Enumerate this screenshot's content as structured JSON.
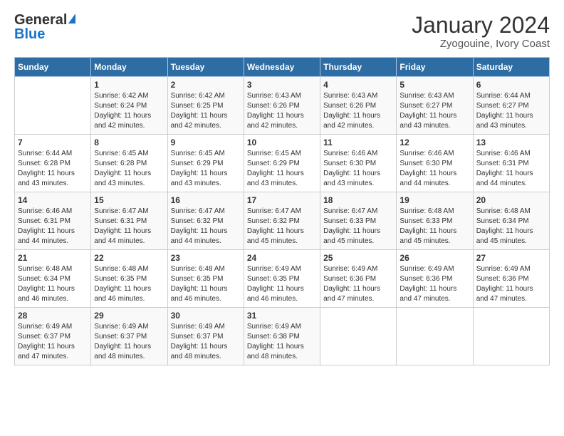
{
  "header": {
    "logo_general": "General",
    "logo_blue": "Blue",
    "month_title": "January 2024",
    "location": "Zyogouine, Ivory Coast"
  },
  "weekdays": [
    "Sunday",
    "Monday",
    "Tuesday",
    "Wednesday",
    "Thursday",
    "Friday",
    "Saturday"
  ],
  "weeks": [
    [
      {
        "day": "",
        "info": ""
      },
      {
        "day": "1",
        "info": "Sunrise: 6:42 AM\nSunset: 6:24 PM\nDaylight: 11 hours\nand 42 minutes."
      },
      {
        "day": "2",
        "info": "Sunrise: 6:42 AM\nSunset: 6:25 PM\nDaylight: 11 hours\nand 42 minutes."
      },
      {
        "day": "3",
        "info": "Sunrise: 6:43 AM\nSunset: 6:26 PM\nDaylight: 11 hours\nand 42 minutes."
      },
      {
        "day": "4",
        "info": "Sunrise: 6:43 AM\nSunset: 6:26 PM\nDaylight: 11 hours\nand 42 minutes."
      },
      {
        "day": "5",
        "info": "Sunrise: 6:43 AM\nSunset: 6:27 PM\nDaylight: 11 hours\nand 43 minutes."
      },
      {
        "day": "6",
        "info": "Sunrise: 6:44 AM\nSunset: 6:27 PM\nDaylight: 11 hours\nand 43 minutes."
      }
    ],
    [
      {
        "day": "7",
        "info": "Sunrise: 6:44 AM\nSunset: 6:28 PM\nDaylight: 11 hours\nand 43 minutes."
      },
      {
        "day": "8",
        "info": "Sunrise: 6:45 AM\nSunset: 6:28 PM\nDaylight: 11 hours\nand 43 minutes."
      },
      {
        "day": "9",
        "info": "Sunrise: 6:45 AM\nSunset: 6:29 PM\nDaylight: 11 hours\nand 43 minutes."
      },
      {
        "day": "10",
        "info": "Sunrise: 6:45 AM\nSunset: 6:29 PM\nDaylight: 11 hours\nand 43 minutes."
      },
      {
        "day": "11",
        "info": "Sunrise: 6:46 AM\nSunset: 6:30 PM\nDaylight: 11 hours\nand 43 minutes."
      },
      {
        "day": "12",
        "info": "Sunrise: 6:46 AM\nSunset: 6:30 PM\nDaylight: 11 hours\nand 44 minutes."
      },
      {
        "day": "13",
        "info": "Sunrise: 6:46 AM\nSunset: 6:31 PM\nDaylight: 11 hours\nand 44 minutes."
      }
    ],
    [
      {
        "day": "14",
        "info": "Sunrise: 6:46 AM\nSunset: 6:31 PM\nDaylight: 11 hours\nand 44 minutes."
      },
      {
        "day": "15",
        "info": "Sunrise: 6:47 AM\nSunset: 6:31 PM\nDaylight: 11 hours\nand 44 minutes."
      },
      {
        "day": "16",
        "info": "Sunrise: 6:47 AM\nSunset: 6:32 PM\nDaylight: 11 hours\nand 44 minutes."
      },
      {
        "day": "17",
        "info": "Sunrise: 6:47 AM\nSunset: 6:32 PM\nDaylight: 11 hours\nand 45 minutes."
      },
      {
        "day": "18",
        "info": "Sunrise: 6:47 AM\nSunset: 6:33 PM\nDaylight: 11 hours\nand 45 minutes."
      },
      {
        "day": "19",
        "info": "Sunrise: 6:48 AM\nSunset: 6:33 PM\nDaylight: 11 hours\nand 45 minutes."
      },
      {
        "day": "20",
        "info": "Sunrise: 6:48 AM\nSunset: 6:34 PM\nDaylight: 11 hours\nand 45 minutes."
      }
    ],
    [
      {
        "day": "21",
        "info": "Sunrise: 6:48 AM\nSunset: 6:34 PM\nDaylight: 11 hours\nand 46 minutes."
      },
      {
        "day": "22",
        "info": "Sunrise: 6:48 AM\nSunset: 6:35 PM\nDaylight: 11 hours\nand 46 minutes."
      },
      {
        "day": "23",
        "info": "Sunrise: 6:48 AM\nSunset: 6:35 PM\nDaylight: 11 hours\nand 46 minutes."
      },
      {
        "day": "24",
        "info": "Sunrise: 6:49 AM\nSunset: 6:35 PM\nDaylight: 11 hours\nand 46 minutes."
      },
      {
        "day": "25",
        "info": "Sunrise: 6:49 AM\nSunset: 6:36 PM\nDaylight: 11 hours\nand 47 minutes."
      },
      {
        "day": "26",
        "info": "Sunrise: 6:49 AM\nSunset: 6:36 PM\nDaylight: 11 hours\nand 47 minutes."
      },
      {
        "day": "27",
        "info": "Sunrise: 6:49 AM\nSunset: 6:36 PM\nDaylight: 11 hours\nand 47 minutes."
      }
    ],
    [
      {
        "day": "28",
        "info": "Sunrise: 6:49 AM\nSunset: 6:37 PM\nDaylight: 11 hours\nand 47 minutes."
      },
      {
        "day": "29",
        "info": "Sunrise: 6:49 AM\nSunset: 6:37 PM\nDaylight: 11 hours\nand 48 minutes."
      },
      {
        "day": "30",
        "info": "Sunrise: 6:49 AM\nSunset: 6:37 PM\nDaylight: 11 hours\nand 48 minutes."
      },
      {
        "day": "31",
        "info": "Sunrise: 6:49 AM\nSunset: 6:38 PM\nDaylight: 11 hours\nand 48 minutes."
      },
      {
        "day": "",
        "info": ""
      },
      {
        "day": "",
        "info": ""
      },
      {
        "day": "",
        "info": ""
      }
    ]
  ]
}
